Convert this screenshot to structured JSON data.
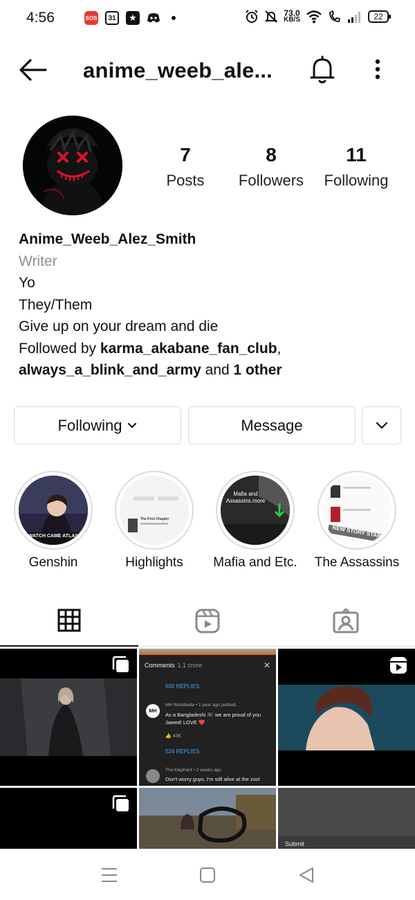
{
  "status_bar": {
    "time": "4:56",
    "sos": "SOS",
    "calendar_day": "31",
    "speed_value": "73.0",
    "speed_unit": "KB/S",
    "battery": "22"
  },
  "header": {
    "username": "anime_weeb_ale..."
  },
  "profile": {
    "posts_count": "7",
    "posts_label": "Posts",
    "followers_count": "8",
    "followers_label": "Followers",
    "following_count": "11",
    "following_label": "Following"
  },
  "bio": {
    "display_name": "Anime_Weeb_Alez_Smith",
    "category": "Writer",
    "line1": "Yo",
    "line2": "They/Them",
    "line3": "Give up on your dream and die",
    "followed_by_prefix": "Followed by ",
    "follower1": "karma_akabane_fan_club",
    "comma": ",",
    "follower2": "always_a_blink_and_army",
    "and_text": " and ",
    "others": "1 other"
  },
  "actions": {
    "following_label": "Following",
    "message_label": "Message"
  },
  "highlights": [
    {
      "label": "Genshin",
      "cover_text": "WATCH CAME ATLAST"
    },
    {
      "label": "Highlights",
      "cover_text": "The First Chapter"
    },
    {
      "label": "Mafia and Etc.",
      "cover_text": "Mafia and Assassins.more"
    },
    {
      "label": "The Assassins",
      "cover_text": "NEW STORY START"
    }
  ],
  "tabs": [
    {
      "name": "posts-grid",
      "icon": "grid-icon"
    },
    {
      "name": "reels",
      "icon": "reels-icon"
    },
    {
      "name": "tagged",
      "icon": "tagged-icon"
    }
  ],
  "posts": {
    "yt_comments": {
      "header": "Comments",
      "count": "1.1 crore",
      "replies1": "500 REPLIES",
      "author1": "MH Worldwide • 1 year ago (edited)",
      "avatar1": "MH",
      "comment1": "As a Bangladeshi 🇧🇩 we are proud of you Jawed! LOVE ❤️",
      "likes1": "👍 43K",
      "replies2": "524 REPLIES",
      "author2": "The Elephant • 2 weeks ago",
      "comment2": "Don't worry guys, I'm still alive at the zoo!"
    },
    "submit_label": "Submit"
  },
  "colors": {
    "border": "#dbdbdb",
    "secondary_text": "#8e8e8e",
    "link_blue": "#3ea6ff"
  }
}
